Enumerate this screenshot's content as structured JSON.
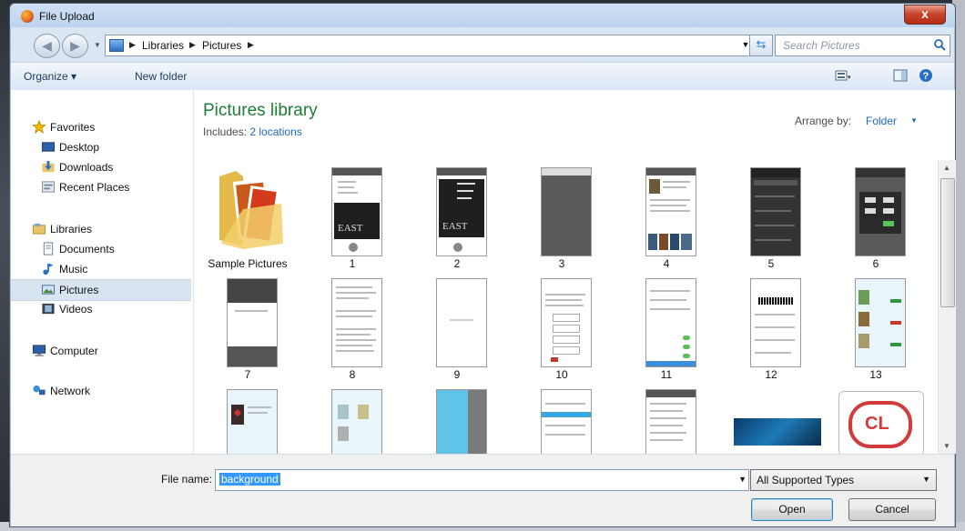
{
  "window": {
    "title": "File Upload",
    "close_glyph": "x"
  },
  "address": {
    "crumbs": [
      "Libraries",
      "Pictures"
    ],
    "search_placeholder": "Search Pictures"
  },
  "toolbar": {
    "organize": "Organize ▾",
    "new_folder": "New folder"
  },
  "nav": {
    "favorites": "Favorites",
    "desktop": "Desktop",
    "downloads": "Downloads",
    "recent_places": "Recent Places",
    "libraries": "Libraries",
    "documents": "Documents",
    "music": "Music",
    "pictures": "Pictures",
    "videos": "Videos",
    "computer": "Computer",
    "network": "Network"
  },
  "library": {
    "title": "Pictures library",
    "includes_label": "Includes:",
    "includes_link": "2 locations",
    "arrange_label": "Arrange by:",
    "arrange_value": "Folder"
  },
  "items": [
    "Sample Pictures",
    "1",
    "2",
    "3",
    "4",
    "5",
    "6",
    "7",
    "8",
    "9",
    "10",
    "11",
    "12",
    "13"
  ],
  "footer": {
    "file_name_label": "File name:",
    "file_name_value": "background",
    "type_value": "All Supported Types",
    "open_label": "Open",
    "cancel_label": "Cancel"
  },
  "colors": {
    "library_title": "#1e7e34",
    "link": "#1f6bbd",
    "selection": "#3399ff"
  }
}
